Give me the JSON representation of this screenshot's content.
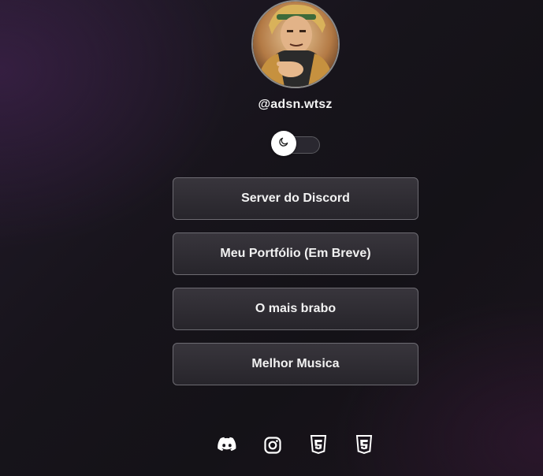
{
  "profile": {
    "username": "@adsn.wtsz"
  },
  "theme_toggle": {
    "icon": "moon-icon"
  },
  "links": [
    {
      "label": "Server do Discord"
    },
    {
      "label": "Meu Portfólio (Em Breve)"
    },
    {
      "label": "O mais brabo"
    },
    {
      "label": "Melhor Musica"
    }
  ],
  "socials": [
    {
      "icon": "discord-icon"
    },
    {
      "icon": "instagram-icon"
    },
    {
      "icon": "html5-icon"
    },
    {
      "icon": "css3-icon"
    }
  ]
}
